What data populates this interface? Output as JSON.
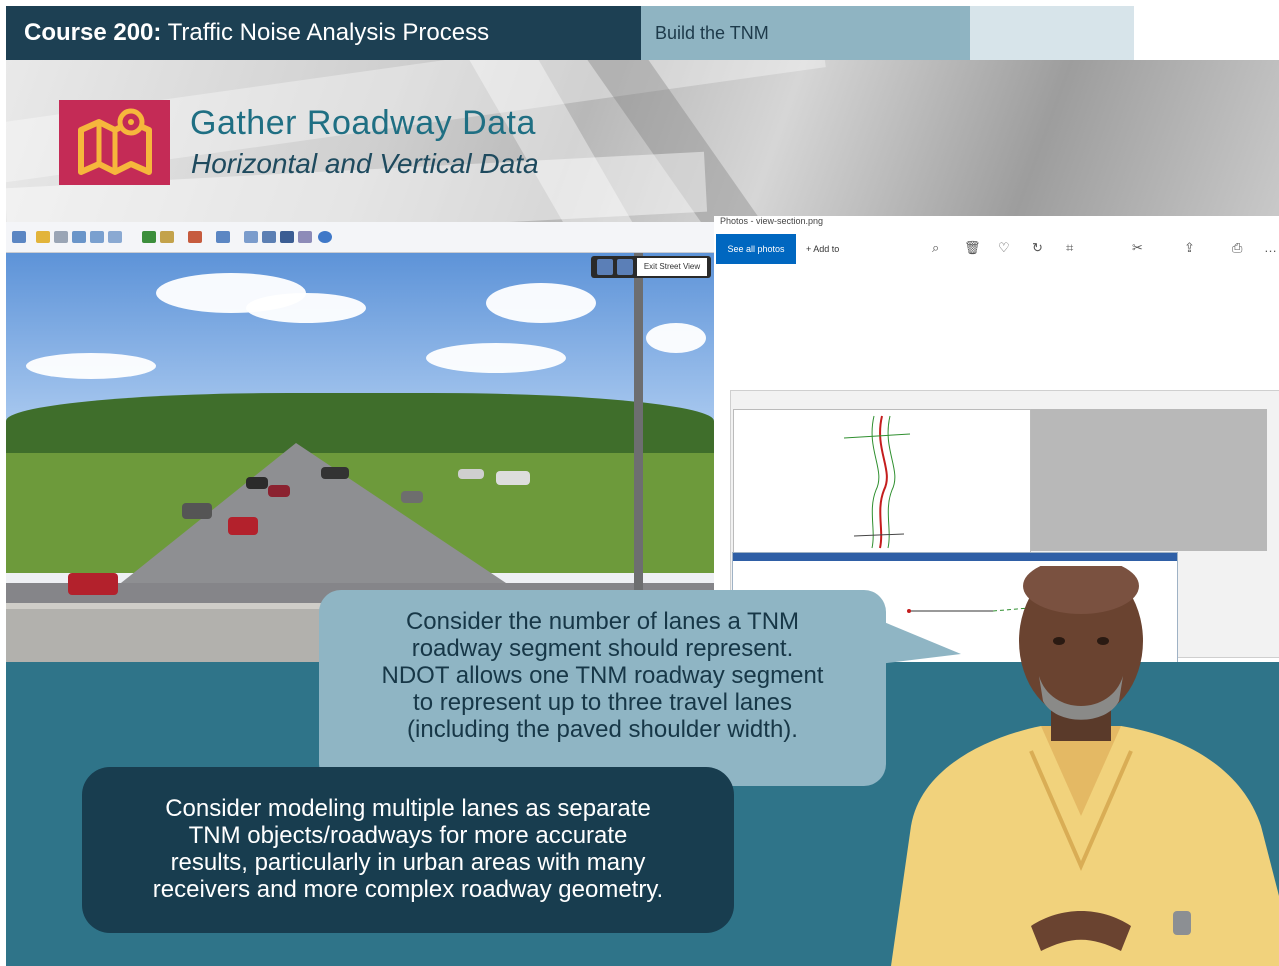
{
  "header": {
    "course_bold": "Course 200:",
    "course_rest": " Traffic Noise Analysis Process",
    "section_tab": "Build the TNM"
  },
  "slide": {
    "title": "Gather Roadway Data",
    "subtitle": "Horizontal and Vertical Data"
  },
  "streetview": {
    "exit_label": "Exit Street View"
  },
  "photos_app": {
    "window_title": "Photos - view-section.png",
    "see_all_label": "See all photos",
    "add_to_label": "Add to"
  },
  "callouts": {
    "upper": [
      "Consider the number of lanes a TNM",
      "roadway segment should represent.",
      "NDOT allows one TNM roadway segment",
      "to represent up to three travel lanes",
      "(including the paved shoulder width)."
    ],
    "lower": [
      "Consider modeling multiple lanes as separate",
      "TNM objects/roadways for more accurate",
      "results, particularly in urban areas with many",
      "receivers and more complex roadway geometry."
    ]
  },
  "colors": {
    "header_bg": "#1d4053",
    "accent_teal": "#2f7489",
    "logo_red": "#c42b56",
    "title_teal": "#1f6f83"
  },
  "icons": [
    "map-pin-icon",
    "checkbox-icon",
    "zoom-icon",
    "delete-icon",
    "favorite-icon",
    "rotate-icon",
    "crop-icon",
    "edit-icon",
    "share-icon",
    "print-icon",
    "more-icon"
  ]
}
